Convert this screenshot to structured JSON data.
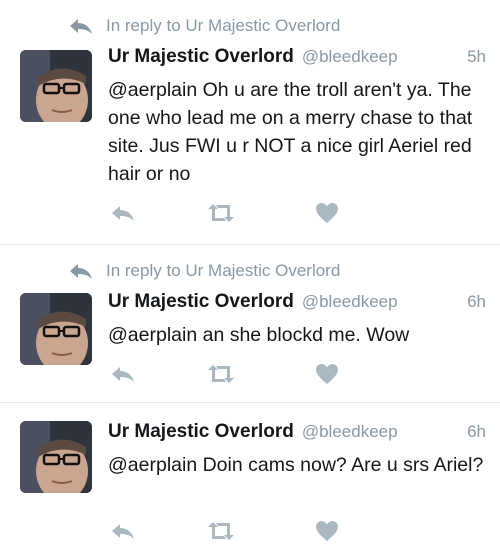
{
  "colors": {
    "name": "#14171a",
    "meta": "#8899a6",
    "action_icon": "#aab8c2",
    "divider": "#e1e8ed"
  },
  "tweets": [
    {
      "reply_to": "In reply to Ur Majestic Overlord",
      "name": "Ur Majestic Overlord",
      "handle": "@bleedkeep",
      "time": "5h",
      "text": "@aerplain Oh u are the troll aren't ya. The one who lead me on a merry chase to that site. Jus FWI u r NOT a nice girl Aeriel red hair or no",
      "actions": [
        "reply-icon",
        "retweet-icon",
        "like-icon"
      ]
    },
    {
      "reply_to": "In reply to Ur Majestic Overlord",
      "name": "Ur Majestic Overlord",
      "handle": "@bleedkeep",
      "time": "6h",
      "text": "@aerplain an she blockd me. Wow",
      "actions": [
        "reply-icon",
        "retweet-icon",
        "like-icon"
      ]
    },
    {
      "name": "Ur Majestic Overlord",
      "handle": "@bleedkeep",
      "time": "6h",
      "text": "@aerplain Doin cams now? Are u srs Ariel?",
      "actions": [
        "reply-icon",
        "retweet-icon",
        "like-icon"
      ]
    }
  ]
}
